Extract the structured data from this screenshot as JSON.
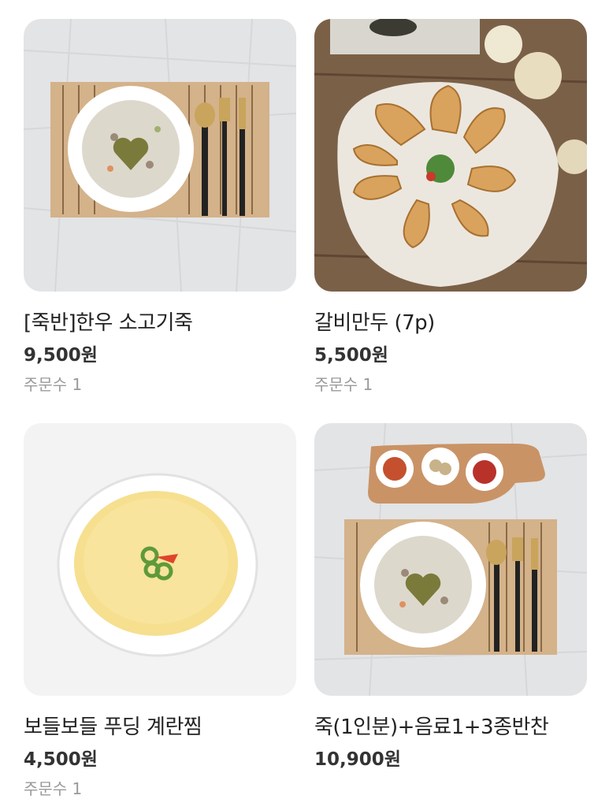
{
  "products": [
    {
      "name": "[죽반]한우 소고기죽",
      "price": "9,500원",
      "orders": "주문수 1",
      "image_icon": "beef-porridge-photo"
    },
    {
      "name": "갈비만두 (7p)",
      "price": "5,500원",
      "orders": "주문수 1",
      "image_icon": "dumplings-photo"
    },
    {
      "name": "보들보들 푸딩 계란찜",
      "price": "4,500원",
      "orders": "주문수 1",
      "image_icon": "steamed-egg-photo"
    },
    {
      "name": "죽(1인분)+음료1+3종반찬",
      "price": "10,900원",
      "image_icon": "porridge-set-photo"
    }
  ]
}
